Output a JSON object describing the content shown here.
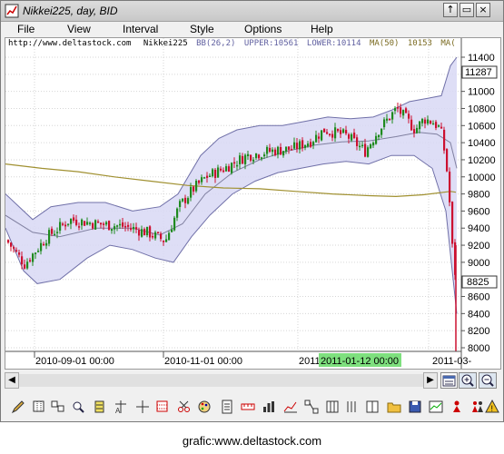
{
  "window": {
    "title": "Nikkei225, day, BID",
    "buttons": [
      "↑",
      "▭",
      "×"
    ]
  },
  "menu": [
    "File",
    "View",
    "Interval",
    "Style",
    "Options",
    "Help"
  ],
  "chart": {
    "header": {
      "url": "http://www.deltastock.com",
      "symbol": "Nikkei225",
      "bb": "BB(26,2)",
      "upper": "UPPER:10561",
      "lower": "LOWER:10114",
      "ma": "MA(50)",
      "ma_value": "10153",
      "ma_suffix": "MA("
    },
    "price_labels": [
      "11400",
      "11200",
      "11000",
      "10800",
      "10600",
      "10400",
      "10200",
      "10000",
      "9800",
      "9600",
      "9400",
      "9200",
      "9000",
      "8800",
      "8600",
      "8400",
      "8200",
      "8000"
    ],
    "top_badge": "11287",
    "last_badge": "8825",
    "date_labels": [
      "2010-09-01 00:00",
      "2010-11-01 00:00",
      "2011",
      "2011-01-12 00:00",
      "2011-03-"
    ],
    "colors": {
      "up": "#1f8a1f",
      "down": "#cc1030",
      "band_fill": "#d8d8f4",
      "band_line": "#7070a8",
      "mid_line": "#8080a0",
      "ma_line": "#a09030",
      "highlight": "#7ee07e"
    }
  },
  "toolbar_icons": [
    "pencil-icon",
    "grid-icon",
    "compare-icon",
    "zoom-icon",
    "bar-icon",
    "crosshair-a-icon",
    "crosshair-b-icon",
    "table-icon",
    "scissors-icon",
    "palette-icon",
    "list-icon",
    "ruler-icon",
    "bars-icon",
    "chart-icon",
    "network-icon",
    "columns-icon",
    "columns2-icon",
    "columns3-icon",
    "folder-icon",
    "save-icon",
    "line-chart-icon",
    "people-icon",
    "people2-icon",
    "info-icon"
  ],
  "caption": "grafic:www.deltastock.com"
}
